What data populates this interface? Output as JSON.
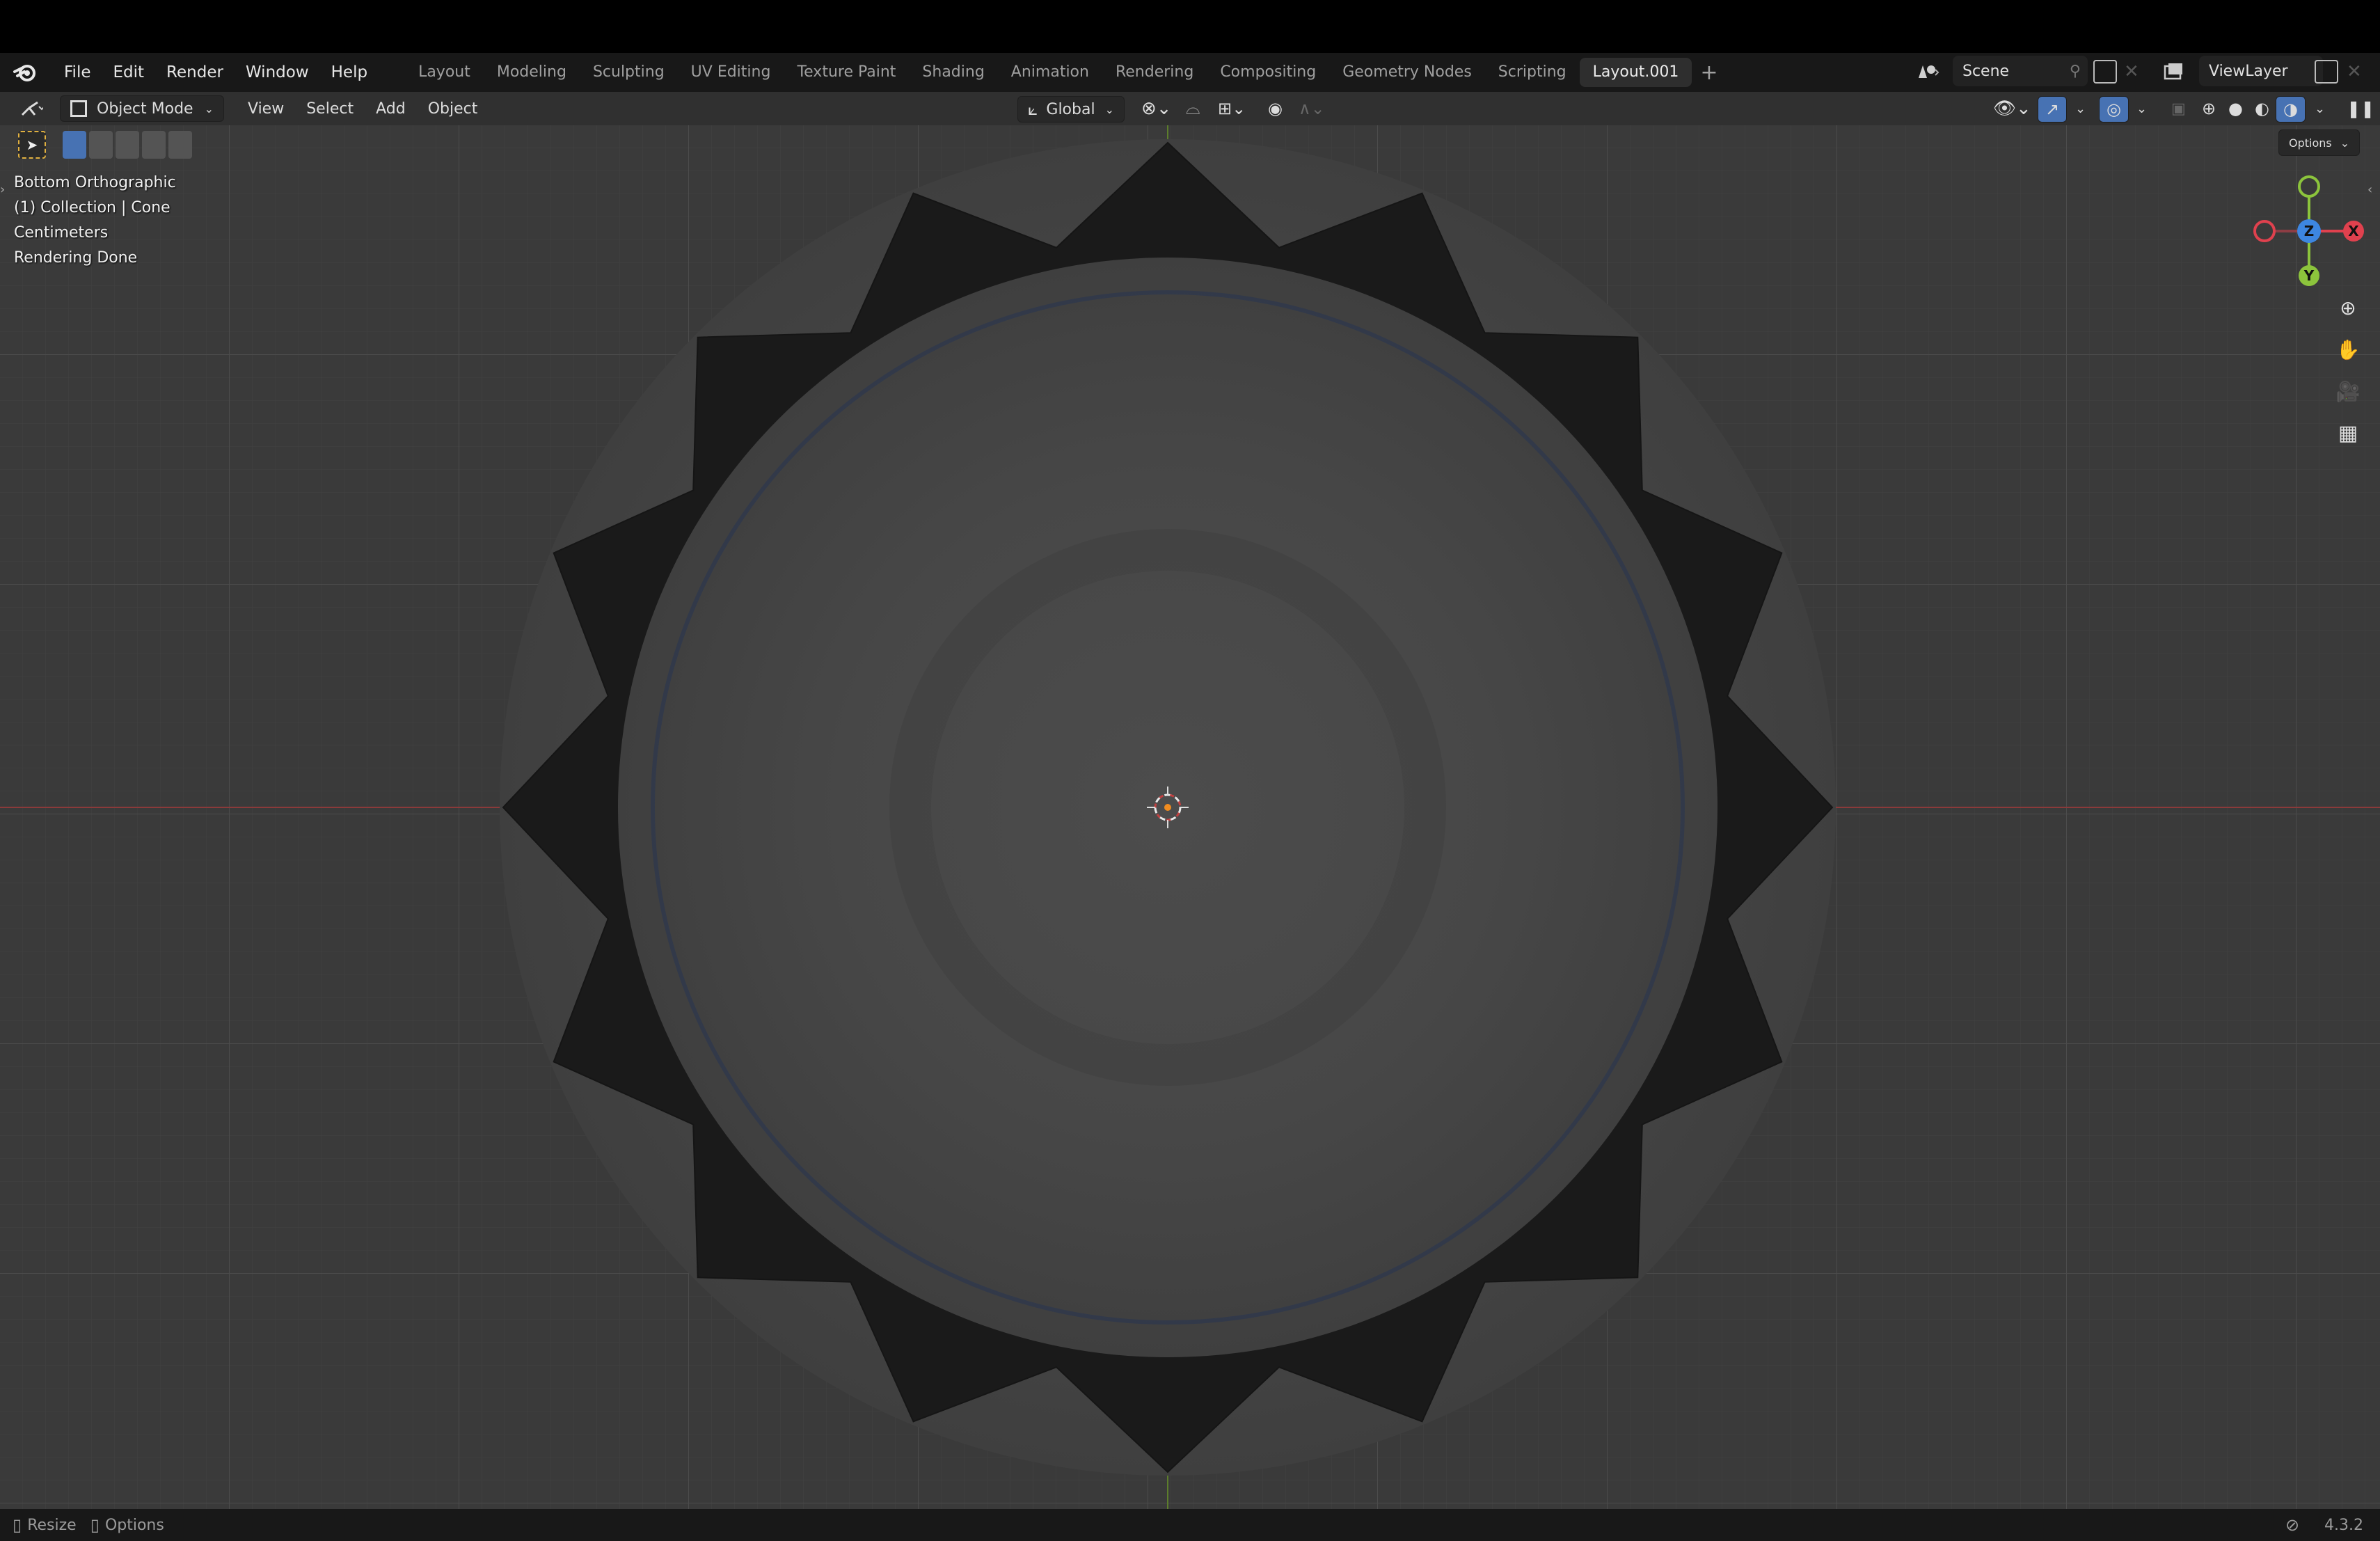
{
  "menubar": {
    "logo": "blender-logo-icon",
    "items": [
      "File",
      "Edit",
      "Render",
      "Window",
      "Help"
    ],
    "workspaces": [
      "Layout",
      "Modeling",
      "Sculpting",
      "UV Editing",
      "Texture Paint",
      "Shading",
      "Animation",
      "Rendering",
      "Compositing",
      "Geometry Nodes",
      "Scripting",
      "Layout.001"
    ],
    "active_workspace": "Layout.001",
    "add_workspace": "+",
    "scene_label": "Scene",
    "view_layer_label": "ViewLayer"
  },
  "header": {
    "mode": "Object Mode",
    "menus": [
      "View",
      "Select",
      "Add",
      "Object"
    ],
    "transform_orientation": "Global",
    "options_label": "Options"
  },
  "overlay": {
    "view_name": "Bottom Orthographic",
    "collection": "(1) Collection | Cone",
    "units": "Centimeters",
    "status": "Rendering Done"
  },
  "gizmo": {
    "axes": [
      "X",
      "Y",
      "Z"
    ],
    "colors": {
      "x": "#e0414e",
      "y": "#8cc43c",
      "z": "#3d86e0"
    }
  },
  "statusbar": {
    "resize_label": "Resize",
    "options_label": "Options",
    "version": "4.3.2"
  },
  "colors": {
    "viewport_bg": "#3a3a3a",
    "x_axis_line": "#8a3a3a",
    "y_axis_line": "#5c7d2c",
    "active_blue": "#4772b3"
  }
}
